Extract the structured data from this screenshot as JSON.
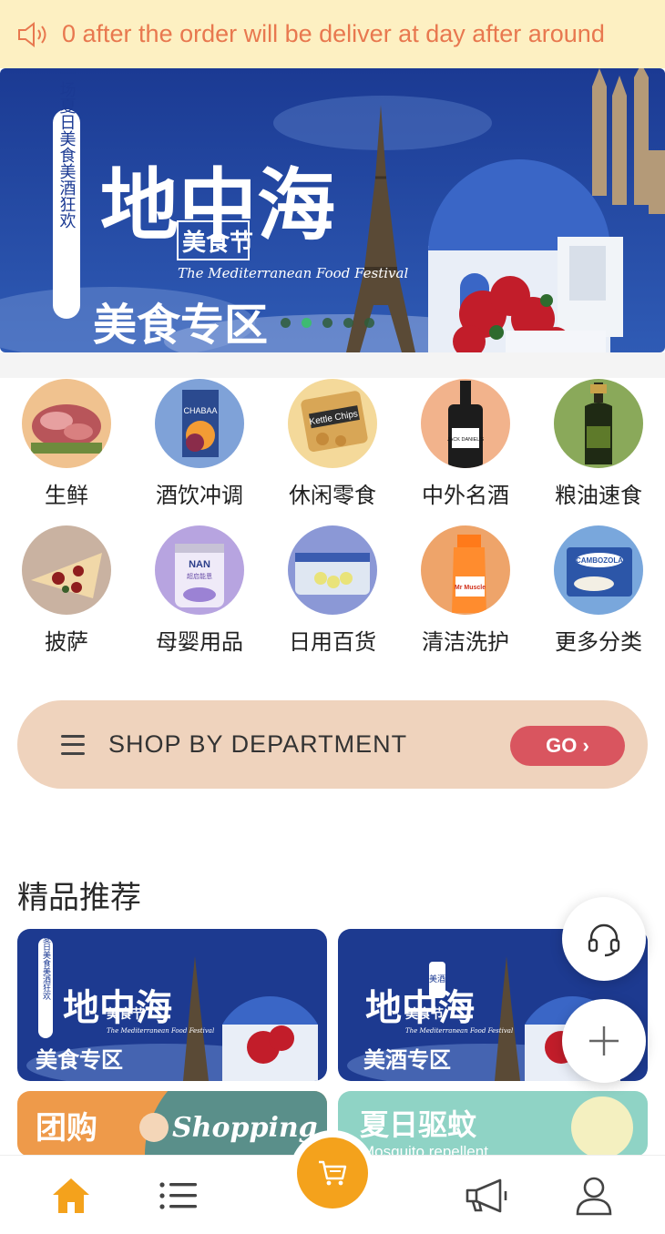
{
  "notice": {
    "icon": "speaker-icon",
    "text": "0 after the order will be deliver at day after around"
  },
  "hero": {
    "side_text": "邂逅一场夏日美食美酒狂欢",
    "title_big": "地中海",
    "title_small": "美食节",
    "english": "The Mediterranean Food Festival",
    "zone": "美食专区",
    "dots_count": 5,
    "active_dot": 2
  },
  "categories": [
    {
      "label": "生鲜",
      "icon": "fresh-meat-icon"
    },
    {
      "label": "酒饮冲调",
      "icon": "juice-drink-icon"
    },
    {
      "label": "休闲零食",
      "icon": "kettle-chips-icon"
    },
    {
      "label": "中外名酒",
      "icon": "whiskey-bottle-icon"
    },
    {
      "label": "粮油速食",
      "icon": "oil-bottle-icon"
    },
    {
      "label": "披萨",
      "icon": "pizza-icon"
    },
    {
      "label": "母婴用品",
      "icon": "baby-formula-icon"
    },
    {
      "label": "日用百货",
      "icon": "storage-box-icon"
    },
    {
      "label": "清洁洗护",
      "icon": "cleaner-spray-icon"
    },
    {
      "label": "更多分类",
      "icon": "cheese-icon"
    }
  ],
  "category_images_text": {
    "juice_brand": "CHABAA",
    "chips_brand": "Kettle Chips",
    "whiskey_brand": "JACK DANIEL'S",
    "formula_brand": "NAN",
    "formula_sub": "超启能恩",
    "spray_brand": "Mr Muscle",
    "cheese_brand": "CAMBOZOLA"
  },
  "department": {
    "label": "SHOP BY DEPARTMENT",
    "button": "GO ›"
  },
  "featured": {
    "title": "精品推荐",
    "cards": [
      {
        "big": "地中海",
        "small": "美食节",
        "english": "The Mediterranean Food Festival",
        "zone": "美食专区",
        "side": "邂逅一场夏日美食美酒狂欢"
      },
      {
        "big": "地中海",
        "small": "美食节",
        "tag": "美酒",
        "english": "The Mediterranean Food Festival",
        "zone": "美酒专区"
      },
      {
        "big": "团购",
        "script": "Shopping"
      },
      {
        "big": "夏日驱蚊",
        "sub": "Mosquito repellent"
      }
    ]
  },
  "fabs": [
    "headset-icon",
    "plus-icon"
  ],
  "tabbar": [
    "home-icon",
    "list-icon",
    "cart-icon",
    "megaphone-icon",
    "user-icon"
  ],
  "colors": {
    "notice_bg": "#fdf0c2",
    "notice_text": "#e8784f",
    "accent_orange": "#f4a21c",
    "go_red": "#d9555f",
    "banner_blue": "#1f3a8a",
    "dept_bg": "#efd3bd"
  }
}
